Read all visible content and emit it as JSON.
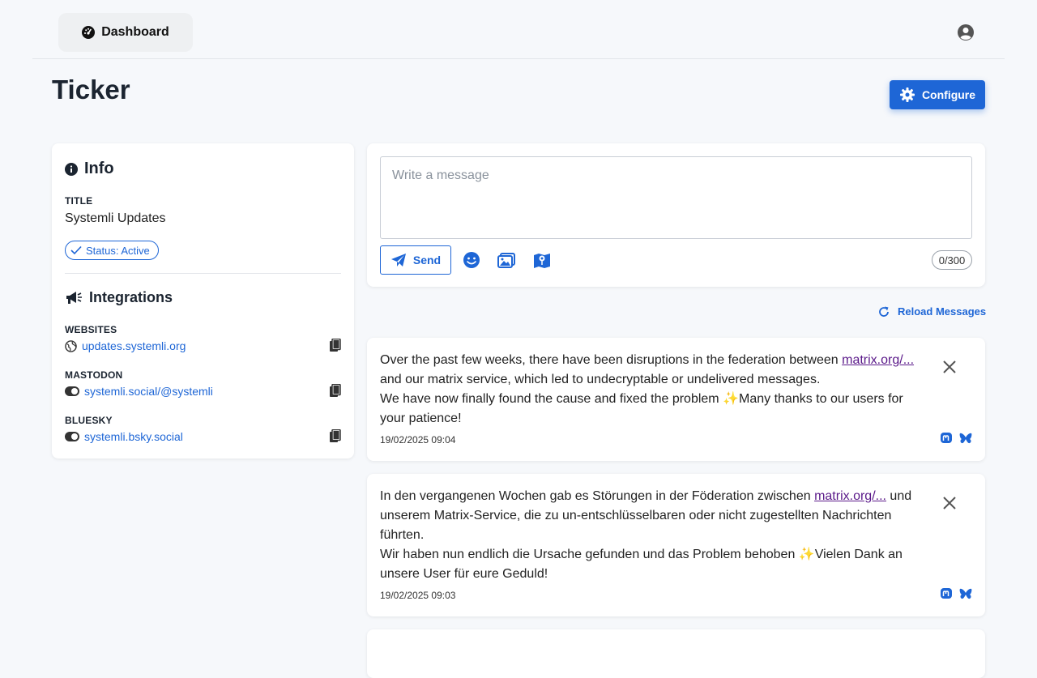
{
  "nav": {
    "dashboard_label": "Dashboard"
  },
  "header": {
    "title": "Ticker",
    "configure_label": "Configure"
  },
  "info": {
    "heading": "Info",
    "title_label": "TITLE",
    "title_value": "Systemli Updates",
    "status": "Status: Active"
  },
  "integrations": {
    "heading": "Integrations",
    "items": [
      {
        "label": "WEBSITES",
        "value": "updates.systemli.org"
      },
      {
        "label": "MASTODON",
        "value": "systemli.social/@systemli"
      },
      {
        "label": "BLUESKY",
        "value": "systemli.bsky.social"
      }
    ]
  },
  "composer": {
    "placeholder": "Write a message",
    "send_label": "Send",
    "counter": "0/300"
  },
  "reload_label": "Reload Messages",
  "messages": [
    {
      "line1_pre": "Over the past few weeks, there have been disruptions in the federation between ",
      "link": "matrix.org/...",
      "line1_post": " and our matrix service, which led to undecryptable or undelivered messages.",
      "line2": "We have now finally found the cause and fixed the problem ✨Many thanks to our users for your patience!",
      "time": "19/02/2025 09:04"
    },
    {
      "line1_pre": "In den vergangenen Wochen gab es Störungen in der Föderation zwischen ",
      "link": "matrix.org/...",
      "line1_post": " und unserem Matrix-Service, die zu un-entschlüsselbaren oder nicht zugestellten Nachrichten führten.",
      "line2": "Wir haben nun endlich die Ursache gefunden und das Problem behoben ✨Vielen Dank an unsere User für eure Geduld!",
      "time": "19/02/2025 09:03"
    }
  ],
  "colors": {
    "accent": "#1e66d6",
    "link_visited": "#5b1a8a",
    "background": "#f6f8fb"
  }
}
